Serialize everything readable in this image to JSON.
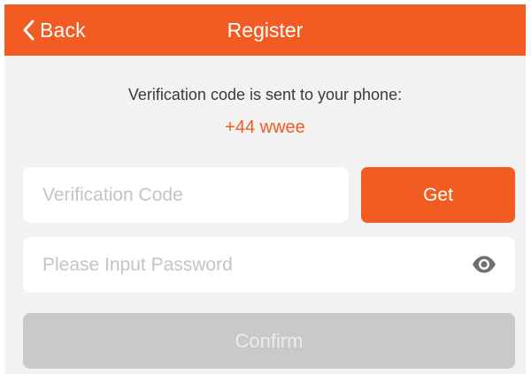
{
  "header": {
    "back_label": "Back",
    "title": "Register",
    "background_color": "#f25c22",
    "back_icon": "chevron-left-icon"
  },
  "message": {
    "text": "Verification code is sent to your phone:",
    "phone": "+44 wwee",
    "phone_color": "#f25c22"
  },
  "form": {
    "code": {
      "placeholder": "Verification Code",
      "value": ""
    },
    "get_label": "Get",
    "password": {
      "placeholder": "Please Input Password",
      "value": "",
      "toggle_icon": "eye-icon"
    },
    "confirm_label": "Confirm",
    "confirm_state": "disabled"
  }
}
